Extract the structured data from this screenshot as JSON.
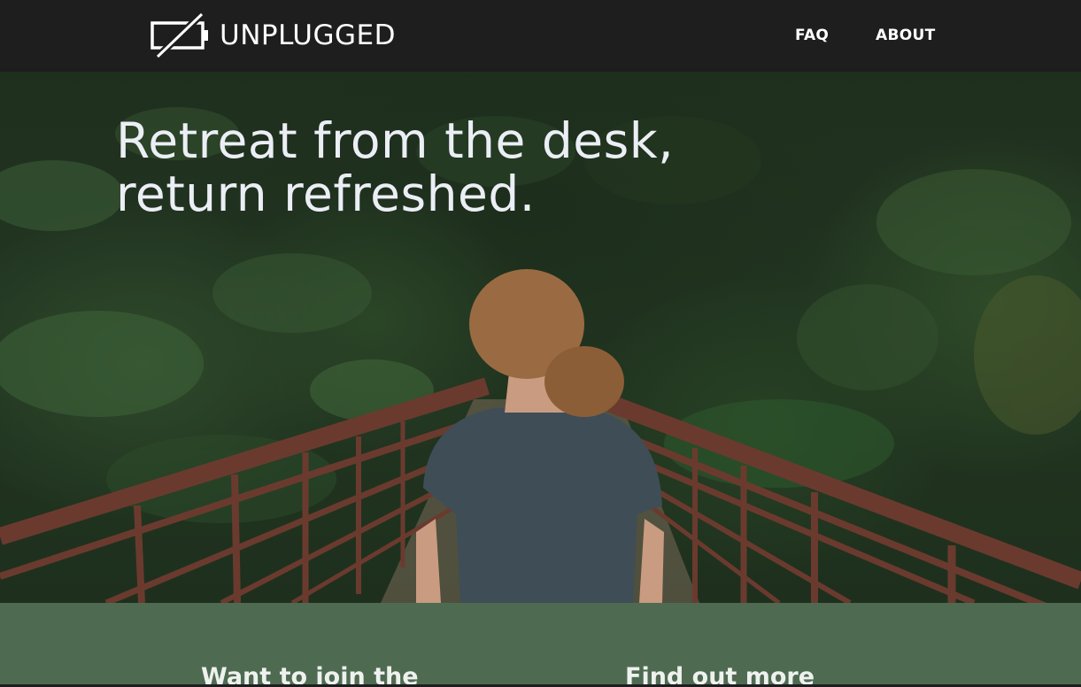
{
  "header": {
    "brand": "UNPLUGGED",
    "nav": [
      {
        "label": "FAQ"
      },
      {
        "label": "ABOUT"
      }
    ]
  },
  "hero": {
    "title_lines": [
      "Retreat from the desk,",
      "return refreshed."
    ]
  },
  "band": {
    "left_heading": "Want to join the",
    "right_heading": "Find out more"
  },
  "colors": {
    "nav_bg": "#1e1e1e",
    "band_bg": "#4e6b52",
    "title_text": "#eceef5",
    "bridge_rust": "#6b3a2e"
  },
  "icons": {
    "logo": "unplugged-battery-icon"
  }
}
